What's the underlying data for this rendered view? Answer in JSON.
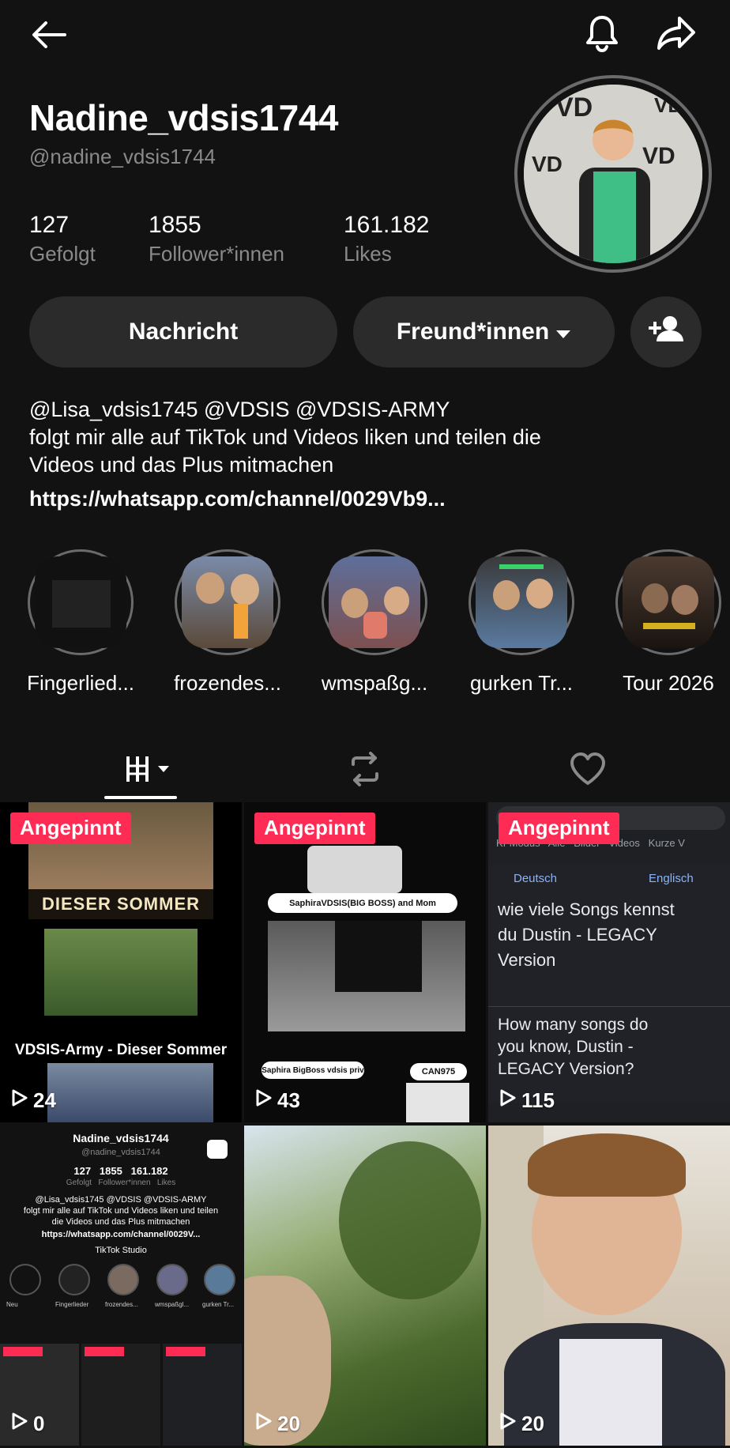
{
  "header": {
    "display_name": "Nadine_vdsis1744",
    "handle": "@nadine_vdsis1744"
  },
  "stats": [
    {
      "value": "127",
      "label": "Gefolgt"
    },
    {
      "value": "1855",
      "label": "Follower*innen"
    },
    {
      "value": "161.182",
      "label": "Likes"
    }
  ],
  "actions": {
    "message_label": "Nachricht",
    "friends_label": "Freund*innen"
  },
  "bio": {
    "line1": "@Lisa_vdsis1745  @VDSIS @VDSIS-ARMY",
    "line2": "folgt mir alle auf TikTok und Videos liken und teilen die",
    "line3": "Videos und das Plus mitmachen",
    "link": "https://whatsapp.com/channel/0029Vb9..."
  },
  "highlights": [
    {
      "label": "Fingerlied..."
    },
    {
      "label": "frozendes..."
    },
    {
      "label": "wmspaßg..."
    },
    {
      "label": "gurken Tr..."
    },
    {
      "label": "Tour 2026"
    }
  ],
  "videos": [
    {
      "pinned": "Angepinnt",
      "views": "24",
      "caption_top": "DIESER SOMMER",
      "caption_bottom": "VDSIS-Army - Dieser Sommer"
    },
    {
      "pinned": "Angepinnt",
      "views": "43",
      "caption_tag": "SaphiraVDSIS(BIG BOSS) and Mom",
      "caption_tag2": "Saphira BigBoss vdsis priv",
      "caption_tag3": "CAN975"
    },
    {
      "pinned": "Angepinnt",
      "views": "115",
      "lang_from": "Deutsch",
      "lang_to": "Englisch",
      "source_text": "wie viele Songs kennst du Dustin - LEGACY Version",
      "translated_text": "How many songs do you know, Dustin - LEGACY Version?",
      "tabs": "KI-Modus   Alle   Bilder   Videos   Kurze V"
    },
    {
      "pinned": "",
      "views": "0"
    },
    {
      "pinned": "",
      "views": "20"
    },
    {
      "pinned": "",
      "views": "20"
    }
  ],
  "mini_profile": {
    "name": "Nadine_vdsis1744",
    "handle": "@nadine_vdsis1744",
    "stats": "127   1855   161.182",
    "stat_labels": "Gefolgt   Follower*innen   Likes",
    "bio1": "@Lisa_vdsis1745 @VDSIS @VDSIS-ARMY",
    "bio2": "folgt mir alle auf TikTok und Videos liken und teilen",
    "bio3": "die Videos und das Plus mitmachen",
    "link": "https://whatsapp.com/channel/0029V...",
    "studio": "TikTok Studio",
    "hl_labels": [
      "Neu",
      "Fingerlieder",
      "frozendes...",
      "wmspaßgl...",
      "gurken Tr..."
    ]
  },
  "colors": {
    "accent": "#fe2c55",
    "background": "#121212",
    "button": "#2b2b2b",
    "muted": "#8a8a8a"
  }
}
